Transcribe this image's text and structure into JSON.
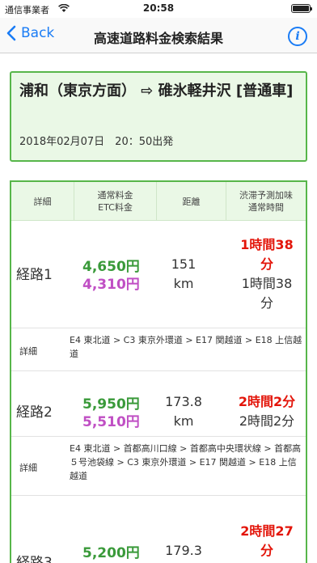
{
  "status": {
    "carrier": "通信事業者",
    "time": "20:58"
  },
  "nav": {
    "back_label": "Back",
    "title": "高速道路料金検索結果",
    "info_label": "i"
  },
  "summary": {
    "route": "浦和（東京方面） ⇨ 碓氷軽井沢 [普通車]",
    "date": "2018年02月07日　20：50出発"
  },
  "colors": {
    "accent_green": "#57b64a",
    "normal_fare": "#3a9a3a",
    "etc_fare": "#c04fc4",
    "delay_red": "#e3150a",
    "ios_blue": "#1a7cf5"
  },
  "table": {
    "headers": {
      "detail": "詳細",
      "fare": "通常料金\nETC料金",
      "distance": "距離",
      "time": "渋滞予測加味\n通常時間"
    },
    "routes": [
      {
        "name": "経路1",
        "fare_normal": "4,650円",
        "fare_etc": "4,310円",
        "distance": "151\nkm",
        "delay_time": "1時間38\n分",
        "normal_time": "1時間38\n分",
        "detail_label": "詳細",
        "detail": "E4 東北道 > C3 東京外環道 > E17 関越道 > E18 上信越道"
      },
      {
        "name": "経路2",
        "fare_normal": "5,950円",
        "fare_etc": "5,510円",
        "distance": "173.8\nkm",
        "delay_time": "2時間2分",
        "normal_time": "2時間2分",
        "detail_label": "詳細",
        "detail": "E4 東北道 > 首都高川口線 > 首都高中央環状線 > 首都高５号池袋線 > C3 東京外環道 > E17 関越道 > E18 上信越道"
      },
      {
        "name": "経路3",
        "fare_normal": "5,200円",
        "distance": "179.3",
        "delay_time": "2時間27\n分"
      }
    ]
  }
}
